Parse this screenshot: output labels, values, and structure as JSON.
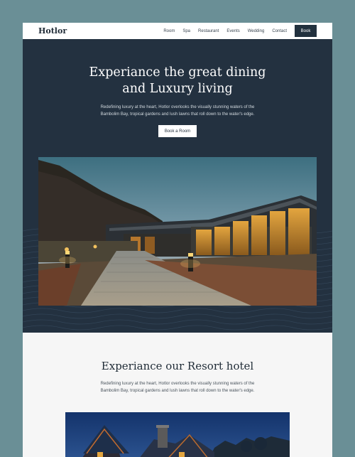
{
  "nav": {
    "logo": "Hotlor",
    "items": [
      {
        "label": "Room"
      },
      {
        "label": "Spa"
      },
      {
        "label": "Restaurant"
      },
      {
        "label": "Events"
      },
      {
        "label": "Wedding"
      },
      {
        "label": "Contact"
      }
    ],
    "book_label": "Book"
  },
  "hero": {
    "title_line1": "Experiance the great dining",
    "title_line2": "and Luxury living",
    "description_line1": "Redefining luxury at the heart, Hotlor overlooks the visually stunning waters of the",
    "description_line2": "Bambolim Bay, tropical gardens and lush lawns that roll down to the water's edge.",
    "button_label": "Book a Room"
  },
  "resort": {
    "title": "Experiance our Resort hotel",
    "description_line1": "Redefining luxury at the heart, Hotlor overlooks the visually stunning waters of the",
    "description_line2": "Bambolim Bay, tropical gardens and lush lawns that roll down to the water's edge."
  },
  "colors": {
    "page_bg": "#6a8f96",
    "hero_bg": "#233140",
    "accent": "#22313e"
  }
}
